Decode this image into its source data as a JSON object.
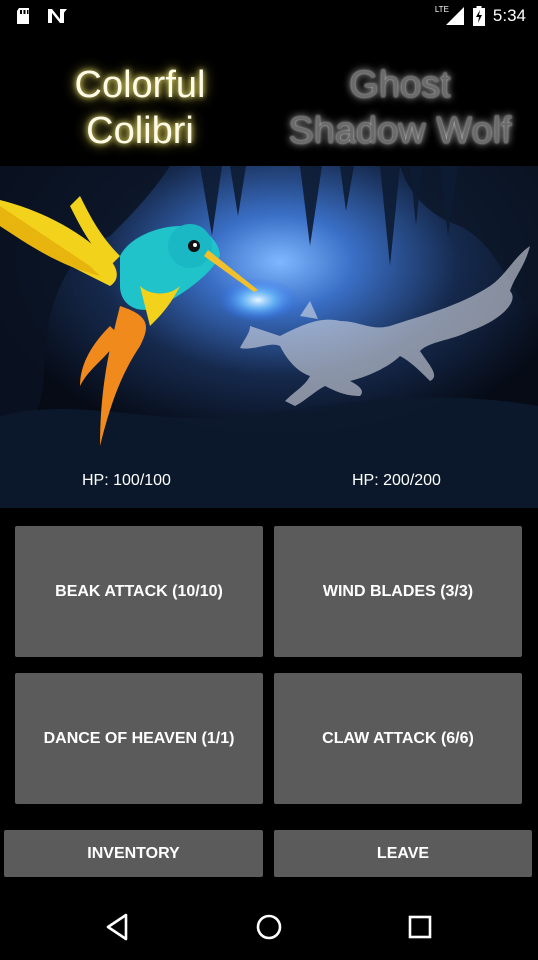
{
  "status_bar": {
    "time": "5:34",
    "network": "LTE",
    "icons": [
      "sd-card-icon",
      "no-signal-n-icon",
      "lte-signal-icon",
      "battery-charging-icon"
    ]
  },
  "battle": {
    "player_name_line1": "Colorful",
    "player_name_line2": "Colibri",
    "enemy_name_line1": "Ghost",
    "enemy_name_line2": "Shadow Wolf",
    "player_hp": "HP: 100/100",
    "enemy_hp": "HP: 200/200"
  },
  "moves": {
    "move1": "BEAK ATTACK (10/10)",
    "move2": "WIND BLADES (3/3)",
    "move3": "DANCE OF HEAVEN (1/1)",
    "move4": "CLAW ATTACK (6/6)"
  },
  "actions": {
    "inventory": "INVENTORY",
    "leave": "LEAVE"
  },
  "colors": {
    "button_bg": "#5b5b5b",
    "player_glow": "#f3e97a",
    "enemy_text": "#6b6b6b"
  }
}
